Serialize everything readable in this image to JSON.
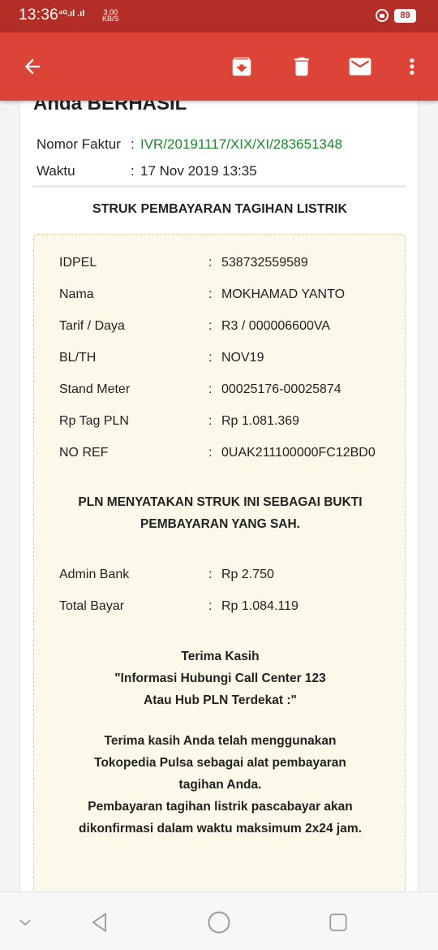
{
  "status_bar": {
    "time": "13:36",
    "signal": "⁴ᴳ.ıl .ıl",
    "net_speed_value": "3.00",
    "net_speed_unit": "KB/S",
    "battery": "89"
  },
  "app_bar": {
    "back_icon": "arrow-left-icon",
    "archive_icon": "archive-icon",
    "delete_icon": "trash-icon",
    "mail_icon": "mail-icon",
    "more_icon": "more-vert-icon",
    "bg_color": "#db4437"
  },
  "email": {
    "cut_title": "Anda BERHASIL",
    "invoice_label": "Nomor Faktur",
    "invoice_colon": ":",
    "invoice_value": "IVR/20191117/XIX/XI/283651348",
    "time_label": "Waktu",
    "time_colon": ":",
    "time_value": "17 Nov 2019 13:35",
    "receipt_title": "STRUK PEMBAYARAN TAGIHAN LISTRIK"
  },
  "receipt": {
    "rows": [
      {
        "label": "IDPEL",
        "colon": ":",
        "value": "538732559589"
      },
      {
        "label": "Nama",
        "colon": ":",
        "value": "MOKHAMAD YANTO"
      },
      {
        "label": "Tarif / Daya",
        "colon": ":",
        "value": "R3 / 000006600VA"
      },
      {
        "label": "BL/TH",
        "colon": ":",
        "value": "NOV19"
      },
      {
        "label": "Stand Meter",
        "colon": ":",
        "value": "00025176-00025874"
      },
      {
        "label": "Rp Tag PLN",
        "colon": ":",
        "value": "Rp 1.081.369"
      },
      {
        "label": "NO REF",
        "colon": ":",
        "value": "0UAK211100000FC12BD0"
      }
    ],
    "statement_line1": "PLN MENYATAKAN STRUK INI SEBAGAI BUKTI",
    "statement_line2": "PEMBAYARAN YANG SAH.",
    "fees": [
      {
        "label": "Admin Bank",
        "colon": ":",
        "value": "Rp 2.750"
      },
      {
        "label": "Total Bayar",
        "colon": ":",
        "value": "Rp 1.084.119"
      }
    ],
    "thanks_line1": "Terima Kasih",
    "thanks_line2": "\"Informasi Hubungi Call Center 123",
    "thanks_line3": "Atau Hub PLN Terdekat :\"",
    "note_line1": "Terima kasih Anda telah menggunakan",
    "note_line2": "Tokopedia Pulsa sebagai alat pembayaran",
    "note_line3": "tagihan Anda.",
    "note_line4": "Pembayaran tagihan listrik pascabayar akan",
    "note_line5": "dikonfirmasi dalam waktu maksimum 2x24 jam."
  },
  "nav_bar": {
    "down_icon": "chevron-down-icon",
    "back_icon": "triangle-back-icon",
    "home_icon": "circle-home-icon",
    "recents_icon": "square-recents-icon"
  }
}
